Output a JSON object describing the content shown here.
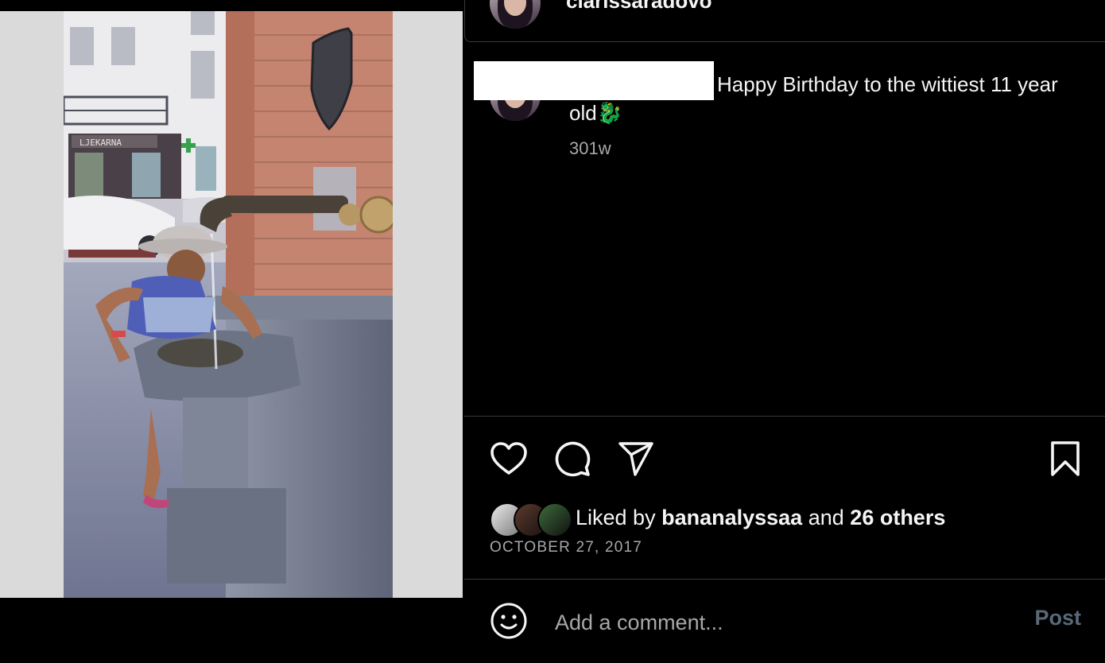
{
  "post": {
    "username": "clarissaradovo",
    "caption": "Happy Birthday to the wittiest 11 year old🐉",
    "caption_time": "301w",
    "date": "OCTOBER 27, 2017",
    "likes": {
      "prefix": "Liked by",
      "user": "bananalyssaa",
      "joiner": "and",
      "others": "26 others"
    },
    "photo": {
      "shop_sign": "LJEKARNA"
    }
  },
  "actions": {
    "like_icon": "heart-icon",
    "comment_icon": "comment-bubble-icon",
    "share_icon": "paper-plane-icon",
    "save_icon": "bookmark-icon"
  },
  "comment_box": {
    "placeholder": "Add a comment...",
    "post_label": "Post",
    "emoji_icon": "smiley-icon"
  },
  "colors": {
    "background": "#000000",
    "text": "#f5f5f5",
    "muted": "#a8a8a8",
    "post_disabled": "#596978",
    "divider": "#3a3a3a"
  }
}
